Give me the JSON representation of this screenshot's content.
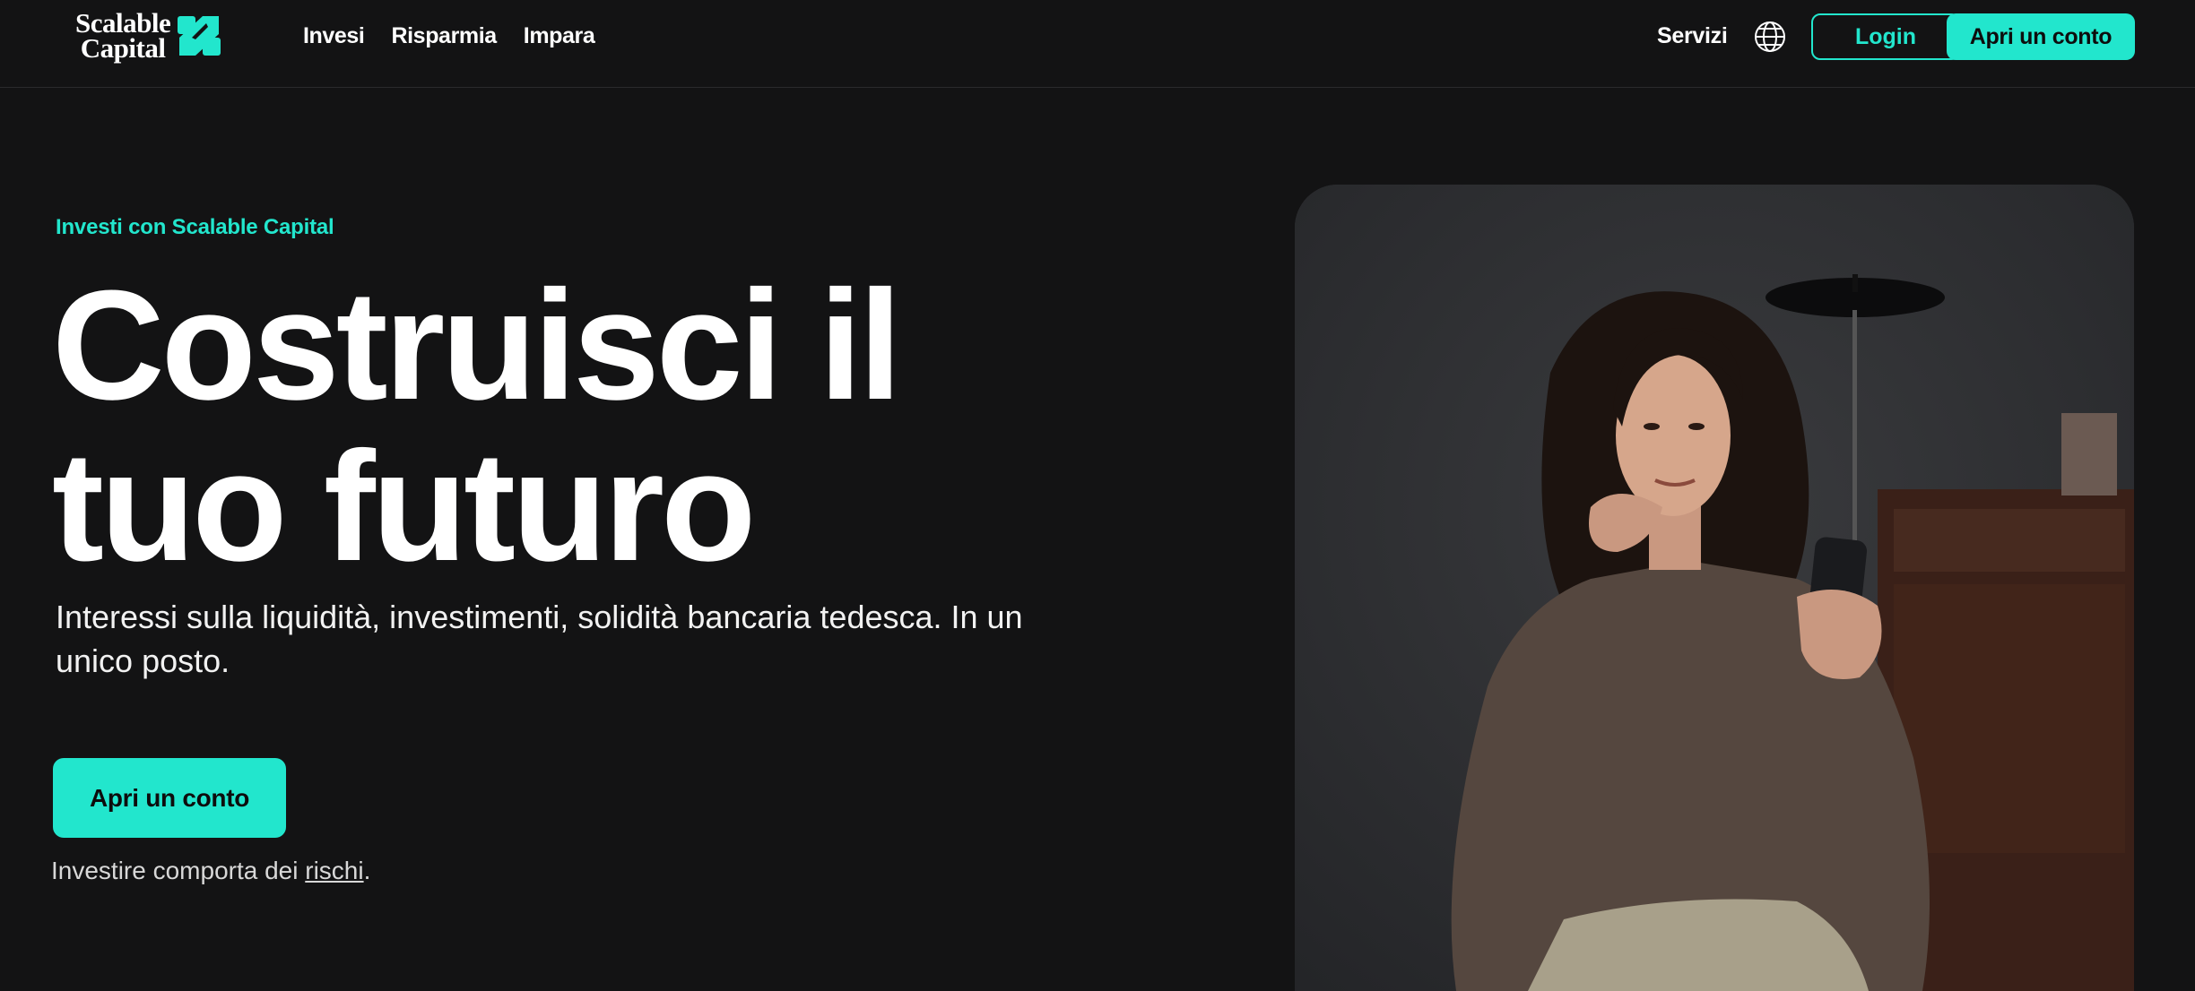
{
  "header": {
    "logo": {
      "line1": "Scalable",
      "line2": "Capital"
    },
    "nav": [
      {
        "label": "Invesi"
      },
      {
        "label": "Risparmia"
      },
      {
        "label": "Impara"
      }
    ],
    "servizi_label": "Servizi",
    "login_label": "Login",
    "open_account_label": "Apri un conto"
  },
  "hero": {
    "eyebrow": "Investi con Scalable Capital",
    "headline_line1": "Costruisci il",
    "headline_line2": "tuo futuro",
    "subtitle": "Interessi sulla liquidità, investimenti, solidità bancaria tedesca. In un unico posto.",
    "cta_label": "Apri un conto",
    "risk_prefix": "Investire comporta dei ",
    "risk_link": "rischi",
    "risk_suffix": "."
  },
  "colors": {
    "accent": "#22e6cd",
    "background": "#131314",
    "text": "#ffffff"
  },
  "icons": {
    "language": "globe-icon",
    "logo": "scalable-s-logo-icon"
  }
}
